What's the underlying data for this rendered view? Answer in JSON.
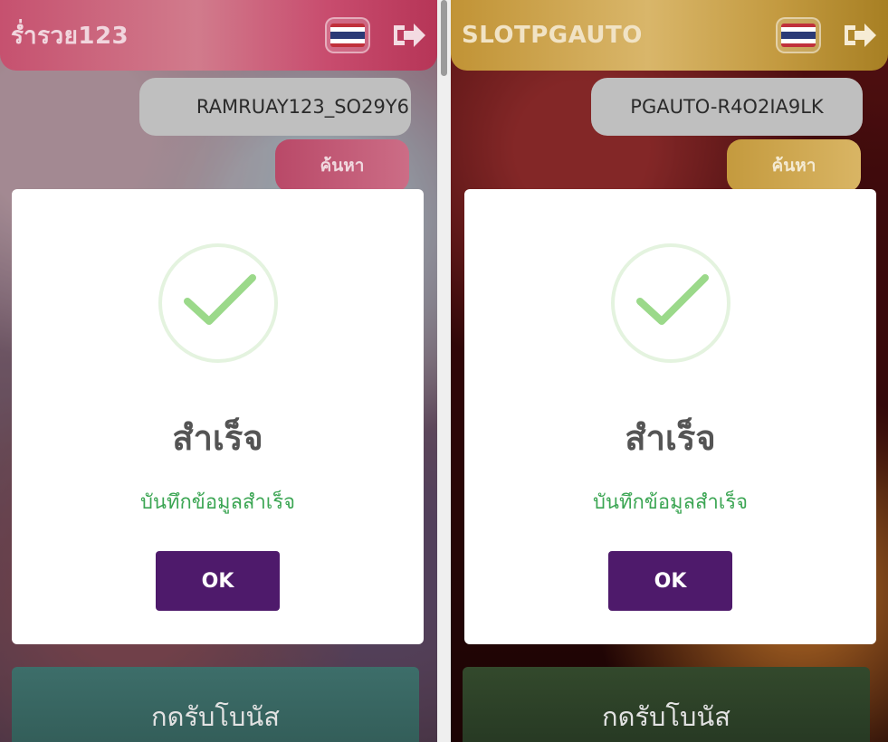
{
  "colors": {
    "ok_button": "#4e1a6b",
    "success_green": "#3ca654",
    "check_green": "#9bd98a",
    "ring_green": "#e4f3df",
    "flag_red": "#c0303b",
    "flag_white": "#ffffff",
    "flag_blue": "#2b3a76"
  },
  "icons": {
    "flag": "thai-flag-icon",
    "logout": "logout-icon",
    "success": "check-icon"
  },
  "panels": [
    {
      "brand": "ร่ำรวย123",
      "user_id": "RAMRUAY123_SO29Y6",
      "search_label": "ค้นหา",
      "bonus_label": "กดรับโบนัส",
      "modal": {
        "title": "สำเร็จ",
        "message": "บันทึกข้อมูลสำเร็จ",
        "ok_label": "OK"
      }
    },
    {
      "brand": "SLOTPGAUTO",
      "user_id": "PGAUTO-R4O2IA9LK",
      "search_label": "ค้นหา",
      "bonus_label": "กดรับโบนัส",
      "modal": {
        "title": "สำเร็จ",
        "message": "บันทึกข้อมูลสำเร็จ",
        "ok_label": "OK"
      }
    }
  ]
}
